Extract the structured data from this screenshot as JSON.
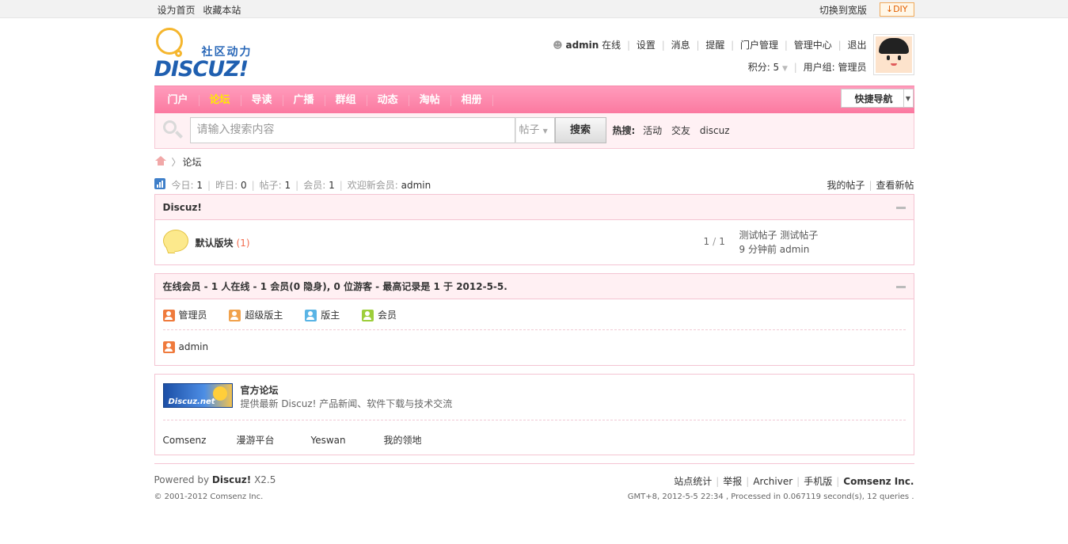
{
  "topbar": {
    "set_home": "设为首页",
    "bookmark": "收藏本站",
    "switch_wide": "切换到宽版",
    "diy": "DIY"
  },
  "logo": {
    "slogan": "社区动力",
    "wordmark": "DISCUZ!"
  },
  "user": {
    "name": "admin",
    "status": "在线",
    "links": [
      "设置",
      "消息",
      "提醒",
      "门户管理",
      "管理中心",
      "退出"
    ],
    "points_label": "积分: 5",
    "group_label": "用户组: 管理员"
  },
  "nav": {
    "items": [
      "门户",
      "论坛",
      "导读",
      "广播",
      "群组",
      "动态",
      "淘帖",
      "相册"
    ],
    "active_index": 1,
    "quick_nav": "快捷导航"
  },
  "search": {
    "placeholder": "请输入搜索内容",
    "type": "帖子",
    "button": "搜索",
    "hot_label": "热搜:",
    "hot_terms": [
      "活动",
      "交友",
      "discuz"
    ]
  },
  "breadcrumb": {
    "current": "论坛"
  },
  "stats": {
    "today_label": "今日:",
    "today": "1",
    "yesterday_label": "昨日:",
    "yesterday": "0",
    "posts_label": "帖子:",
    "posts": "1",
    "members_label": "会员:",
    "members": "1",
    "welcome_label": "欢迎新会员:",
    "welcome_user": "admin",
    "my_posts": "我的帖子",
    "new_posts": "查看新帖"
  },
  "category": {
    "title": "Discuz!",
    "forums": [
      {
        "name": "默认版块",
        "today": "(1)",
        "threads": "1",
        "posts": "1",
        "last_title": "测试帖子 测试帖子",
        "last_meta": "9 分钟前 admin"
      }
    ]
  },
  "online": {
    "title": "在线会员 - 1 人在线 - 1 会员(0 隐身), 0 位游客 - 最高记录是 1 于 2012-5-5.",
    "legend": [
      "管理员",
      "超级版主",
      "版主",
      "会员"
    ],
    "users": [
      "admin"
    ]
  },
  "links": {
    "banner_text": "Discuz.net",
    "title": "官方论坛",
    "desc": "提供最新 Discuz! 产品新闻、软件下载与技术交流",
    "text_links": [
      "Comsenz",
      "漫游平台",
      "Yeswan",
      "我的领地"
    ]
  },
  "footer": {
    "powered_by": "Powered by",
    "product": "Discuz!",
    "version": "X2.5",
    "copyright": "© 2001-2012 Comsenz Inc.",
    "links": [
      "站点统计",
      "举报",
      "Archiver",
      "手机版"
    ],
    "company": "Comsenz Inc.",
    "debug": "GMT+8, 2012-5-5 22:34 , Processed in 0.067119 second(s), 12 queries ."
  }
}
